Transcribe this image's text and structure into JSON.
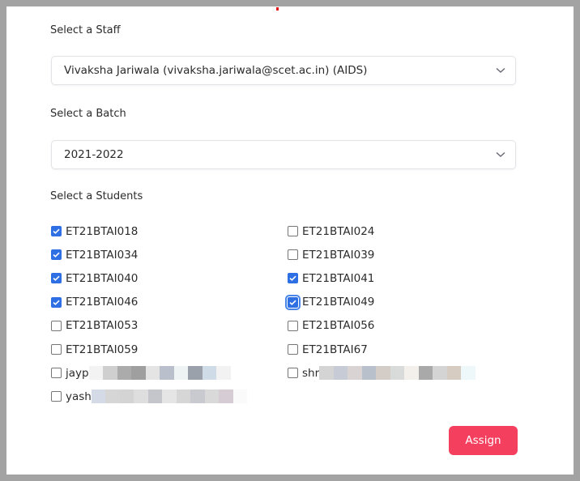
{
  "staff": {
    "label": "Select a Staff",
    "selected": "Vivaksha Jariwala (vivaksha.jariwala@scet.ac.in) (AIDS)"
  },
  "batch": {
    "label": "Select a Batch",
    "selected": "2021-2022"
  },
  "students": {
    "label": "Select a Students",
    "items": [
      {
        "id": "ET21BTAI018",
        "checked": true
      },
      {
        "id": "ET21BTAI024",
        "checked": false
      },
      {
        "id": "ET21BTAI034",
        "checked": true
      },
      {
        "id": "ET21BTAI039",
        "checked": false
      },
      {
        "id": "ET21BTAI040",
        "checked": true
      },
      {
        "id": "ET21BTAI041",
        "checked": true
      },
      {
        "id": "ET21BTAI046",
        "checked": true
      },
      {
        "id": "ET21BTAI049",
        "checked": true,
        "focused": true
      },
      {
        "id": "ET21BTAI053",
        "checked": false
      },
      {
        "id": "ET21BTAI056",
        "checked": false
      },
      {
        "id": "ET21BTAI059",
        "checked": false
      },
      {
        "id": "ET21BTAI67",
        "checked": false
      },
      {
        "id": "jayp",
        "checked": false,
        "redacted": true
      },
      {
        "id": "shr",
        "checked": false,
        "redacted": true
      },
      {
        "id": "yash",
        "checked": false,
        "redacted": true
      }
    ]
  },
  "actions": {
    "assign_label": "Assign"
  },
  "colors": {
    "accent": "#2f6fe4",
    "primary_button": "#f43f5e"
  }
}
